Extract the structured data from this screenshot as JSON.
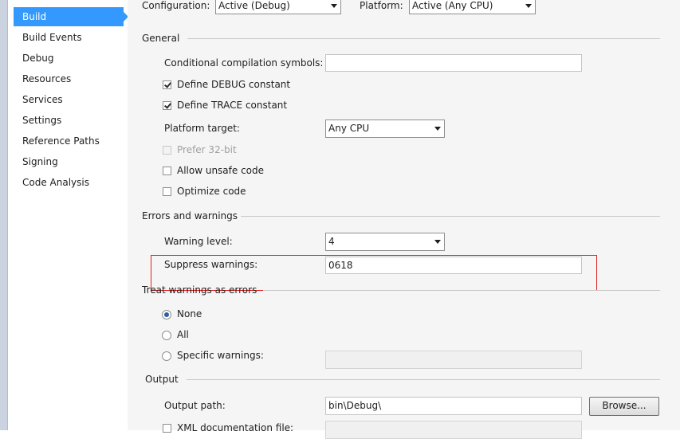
{
  "sidebar": {
    "items": [
      {
        "label": "Build",
        "selected": true
      },
      {
        "label": "Build Events"
      },
      {
        "label": "Debug"
      },
      {
        "label": "Resources"
      },
      {
        "label": "Services"
      },
      {
        "label": "Settings"
      },
      {
        "label": "Reference Paths"
      },
      {
        "label": "Signing"
      },
      {
        "label": "Code Analysis"
      }
    ]
  },
  "header": {
    "configuration_label": "Configuration:",
    "configuration_value": "Active (Debug)",
    "platform_label": "Platform:",
    "platform_value": "Active (Any CPU)"
  },
  "general": {
    "title": "General",
    "conditional_label": "Conditional compilation symbols:",
    "conditional_value": "",
    "define_debug_label": "Define DEBUG constant",
    "define_debug_checked": true,
    "define_trace_label": "Define TRACE constant",
    "define_trace_checked": true,
    "platform_target_label": "Platform target:",
    "platform_target_value": "Any CPU",
    "prefer32_label": "Prefer 32-bit",
    "unsafe_label": "Allow unsafe code",
    "optimize_label": "Optimize code"
  },
  "errors": {
    "title": "Errors and warnings",
    "warning_level_label": "Warning level:",
    "warning_level_value": "4",
    "suppress_label": "Suppress warnings:",
    "suppress_value": "0618"
  },
  "treat": {
    "title": "Treat warnings as errors",
    "none_label": "None",
    "all_label": "All",
    "specific_label": "Specific warnings:",
    "specific_value": ""
  },
  "output": {
    "title": "Output",
    "path_label": "Output path:",
    "path_value": "bin\\Debug\\",
    "browse_label": "Browse...",
    "xml_label": "XML documentation file:"
  },
  "colors": {
    "selection": "#3399ff",
    "highlight_border": "#e02020"
  }
}
